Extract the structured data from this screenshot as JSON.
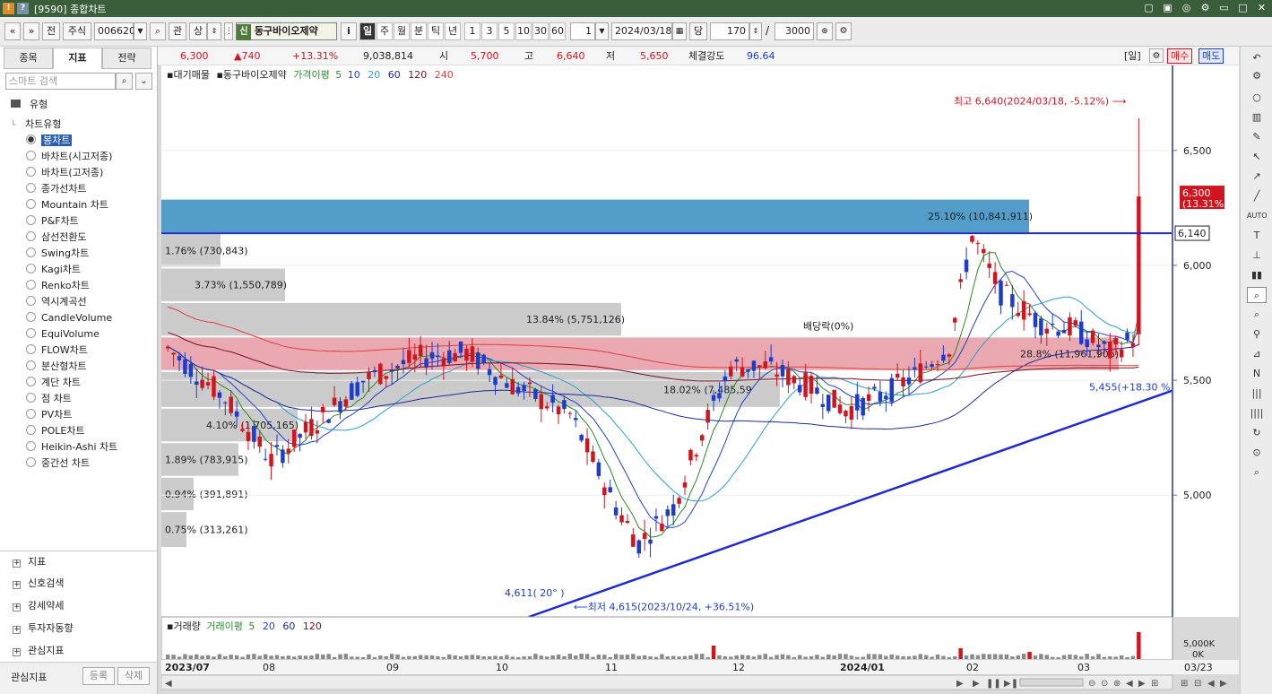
{
  "window": {
    "title": "[9590] 종합차트",
    "icon1": "!",
    "icon2": "?",
    "controls": [
      "▢",
      "▣",
      "◎",
      "⚙",
      "▭",
      "□",
      "✕"
    ]
  },
  "toolbar": {
    "nav_prev": "«",
    "nav_down": "»",
    "jeon": "전",
    "market": "주식",
    "code": "006620",
    "search_icon": "search-icon",
    "gwan": "관",
    "sang": "상",
    "stock_tag": "신",
    "stock_name": "동구바이오제약",
    "info_btn": "i",
    "periods": [
      "일",
      "주",
      "월",
      "분",
      "틱",
      "년"
    ],
    "active_period": "일",
    "intervals": [
      "1",
      "3",
      "5",
      "10",
      "30",
      "60"
    ],
    "interval_value": "1",
    "date": "2024/03/18",
    "dang": "당",
    "count": "170",
    "slash": "/",
    "total": "3000"
  },
  "left_panel": {
    "tabs": [
      "종목",
      "지표",
      "전략"
    ],
    "active_tab": "지표",
    "search_placeholder": "스마트 검색",
    "section_type": "유형",
    "section_chart_type": "차트유형",
    "chart_types": [
      "봉차트",
      "바차트(시고저종)",
      "바차트(고저종)",
      "종가선차트",
      "Mountain 차트",
      "P&F차트",
      "삼선전환도",
      "Swing차트",
      "Kagi차트",
      "Renko차트",
      "역시계곡선",
      "CandleVolume",
      "EquiVolume",
      "FLOW차트",
      "분산형차트",
      "계단 차트",
      "점 차트",
      "PV차트",
      "POLE차트",
      "Heikin-Ashi 차트",
      "중간선 차트"
    ],
    "selected_chart_type": "봉차트",
    "collapsed_sections": [
      "지표",
      "신호검색",
      "강세약세",
      "투자자동향",
      "관심지표"
    ],
    "bottom_label": "관심지표",
    "btn_register": "등록",
    "btn_delete": "삭제"
  },
  "quote": {
    "price": "6,300",
    "change": "▲740",
    "change_pct": "+13.31%",
    "volume": "9,038,814",
    "open_label": "시",
    "open": "5,700",
    "high_label": "고",
    "high": "6,640",
    "low_label": "저",
    "low": "5,650",
    "strength_label": "체결강도",
    "strength": "96.64",
    "period_tag": "[일]",
    "buy_label": "매수",
    "sell_label": "매도"
  },
  "colors": {
    "up": "#d2141e",
    "down": "#1e3cc8",
    "ma5": "#2a8a2a",
    "ma10": "#2040d0",
    "ma20": "#2aa0c8",
    "ma60": "#1c2a9a",
    "ma120": "#7a1020",
    "ma240": "#e04040",
    "profile_gray": "#c8c8c8",
    "profile_red": "#e8a0a8",
    "profile_blue": "#4a98c8"
  },
  "chart_data": {
    "type": "candlestick",
    "title": "동구바이오제약",
    "legend": {
      "prefix1": "대기매물",
      "prefix2": "동구바이오제약",
      "ma_label": "가격이평",
      "ma_periods": [
        "5",
        "10",
        "20",
        "60",
        "120",
        "240"
      ]
    },
    "y_ticks": [
      6500,
      6000,
      5500,
      5000
    ],
    "y_tick_labels": [
      "6,500",
      "6,000",
      "5,500",
      "5,000"
    ],
    "y_range": [
      4470,
      6870
    ],
    "x_labels": [
      "2023/07",
      "08",
      "09",
      "10",
      "11",
      "12",
      "2024/01",
      "02",
      "03"
    ],
    "x_label_right": "03/23",
    "current_price_label": "6,300",
    "current_price_pct": "(13.31%)",
    "current_price": 6300,
    "hline_label": "6,140",
    "hline_value": 6140,
    "annotations": {
      "high": "최고 6,640(2024/03/18, -5.12%)",
      "low": "최저 4,615(2023/10/24, +36.51%)",
      "trend_start": "4,611( 20° )",
      "trend_end": "5,455(+18.30 %)",
      "dividend": "배당락(0%)"
    },
    "volume_profile": [
      {
        "label": "1.76% (730,843)",
        "low": 5990,
        "high": 6140
      },
      {
        "label": "3.73% (1,550,789)",
        "low": 5840,
        "high": 5990
      },
      {
        "label": "13.84% (5,751,126)",
        "low": 5690,
        "high": 5840
      },
      {
        "label": "28.8% (11,961,906)",
        "low": 5540,
        "high": 5690
      },
      {
        "label": "18.02% (7,485,59",
        "low": 5380,
        "high": 5540
      },
      {
        "label": "4.10% (1,705,165)",
        "low": 5230,
        "high": 5380
      },
      {
        "label": "1.89% (783,915)",
        "low": 5080,
        "high": 5230
      },
      {
        "label": "0.94% (391,891)",
        "low": 4930,
        "high": 5080
      },
      {
        "label": "0.75% (313,261)",
        "low": 4770,
        "high": 4930
      },
      {
        "label": "25.10% (10,841,911)",
        "low": 6140,
        "high": 6290
      }
    ],
    "ohlc_sample": {
      "count": 170,
      "first_date": "2023/07",
      "last_close": 6300,
      "last_open": 5700,
      "last_high": 6640,
      "last_low": 5650
    },
    "volume_panel": {
      "legend_prefix": "거래량",
      "ma_label": "거래이평",
      "ma_periods": [
        "5",
        "20",
        "60",
        "120"
      ],
      "y_labels": [
        "5,000K",
        "0K"
      ]
    }
  }
}
